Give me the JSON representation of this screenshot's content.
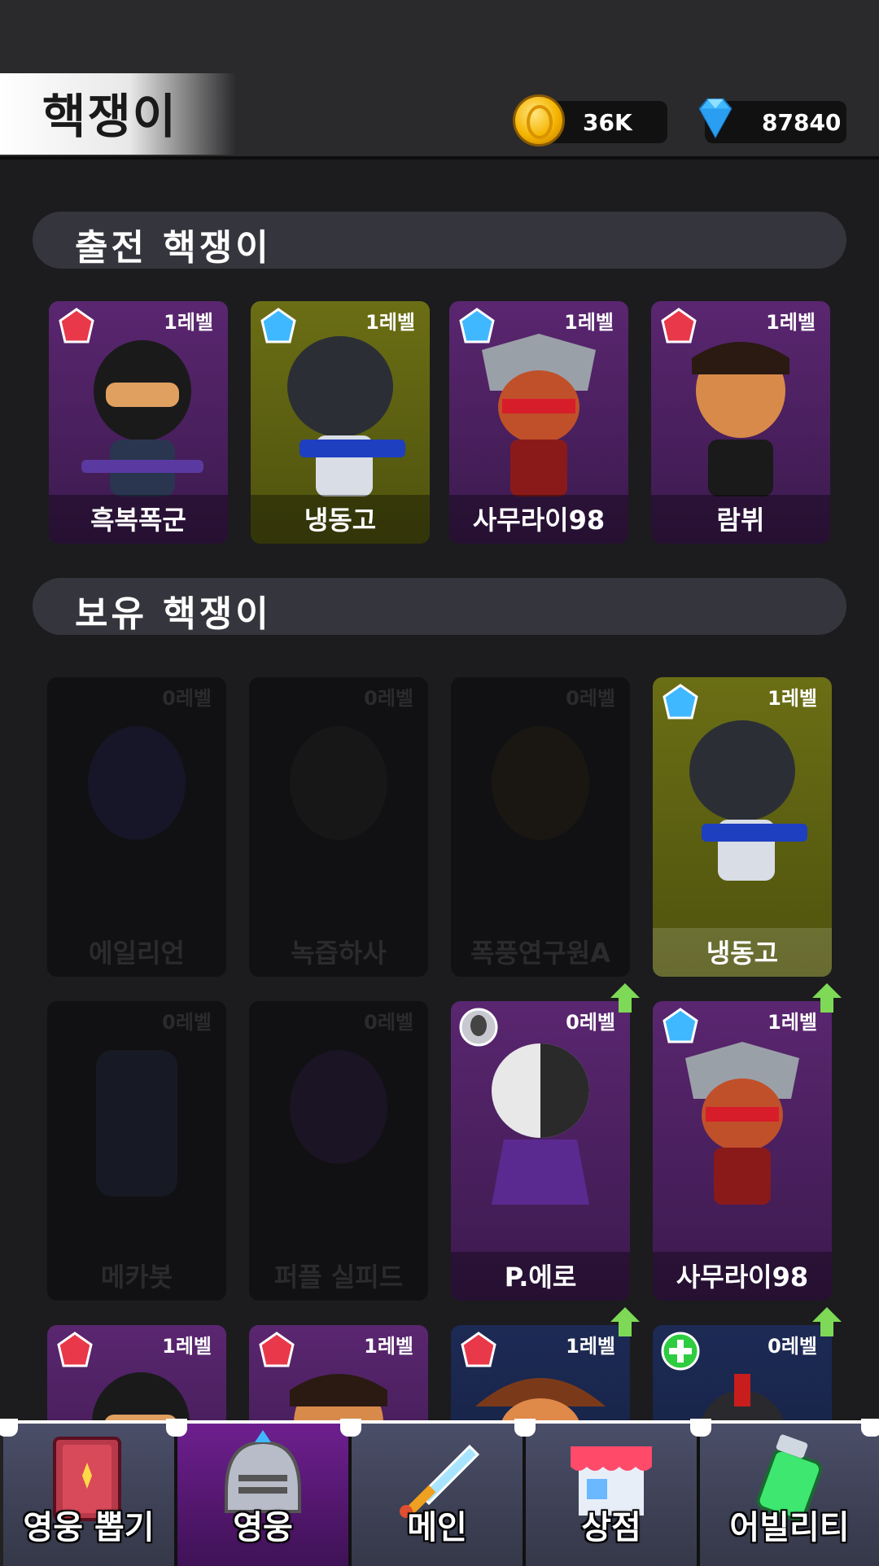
{
  "header": {
    "title": "핵쟁이",
    "coins": "36K",
    "gems": "87840"
  },
  "sections": {
    "deployed": "출전 핵쟁이",
    "owned": "보유 핵쟁이"
  },
  "deployed_cards": [
    {
      "name": "흑복폭군",
      "level": "1레벨",
      "badge": "red-gem-icon"
    },
    {
      "name": "냉동고",
      "level": "1레벨",
      "badge": "blue-gem-icon"
    },
    {
      "name": "사무라이98",
      "level": "1레벨",
      "badge": "blue-gem-icon"
    },
    {
      "name": "람뷔",
      "level": "1레벨",
      "badge": "red-gem-icon"
    }
  ],
  "owned_cards": [
    {
      "name": "에일리언",
      "level": "0레벨",
      "state": "locked"
    },
    {
      "name": "녹즙하사",
      "level": "0레벨",
      "state": "locked"
    },
    {
      "name": "폭풍연구원A",
      "level": "0레벨",
      "state": "locked"
    },
    {
      "name": "냉동고",
      "level": "1레벨",
      "state": "owned"
    },
    {
      "name": "메카봇",
      "level": "0레벨",
      "state": "locked"
    },
    {
      "name": "퍼플 실피드",
      "level": "0레벨",
      "state": "locked"
    },
    {
      "name": "P.에로",
      "level": "0레벨",
      "state": "owned"
    },
    {
      "name": "사무라이98",
      "level": "1레벨",
      "state": "owned"
    },
    {
      "name": "",
      "level": "1레벨",
      "state": "owned"
    },
    {
      "name": "",
      "level": "1레벨",
      "state": "owned"
    },
    {
      "name": "",
      "level": "1레벨",
      "state": "owned"
    },
    {
      "name": "",
      "level": "0레벨",
      "state": "owned"
    }
  ],
  "nav": [
    {
      "label": "영웅 뽑기",
      "icon": "book-icon"
    },
    {
      "label": "영웅",
      "icon": "helmet-icon",
      "active": true
    },
    {
      "label": "메인",
      "icon": "sword-icon"
    },
    {
      "label": "상점",
      "icon": "shop-icon"
    },
    {
      "label": "어빌리티",
      "icon": "potion-icon"
    }
  ],
  "colors": {
    "background": "#1c1c1e",
    "card_purple": "#4a1f5e",
    "card_olive": "#5e6112",
    "nav_active": "#5a1a78"
  }
}
